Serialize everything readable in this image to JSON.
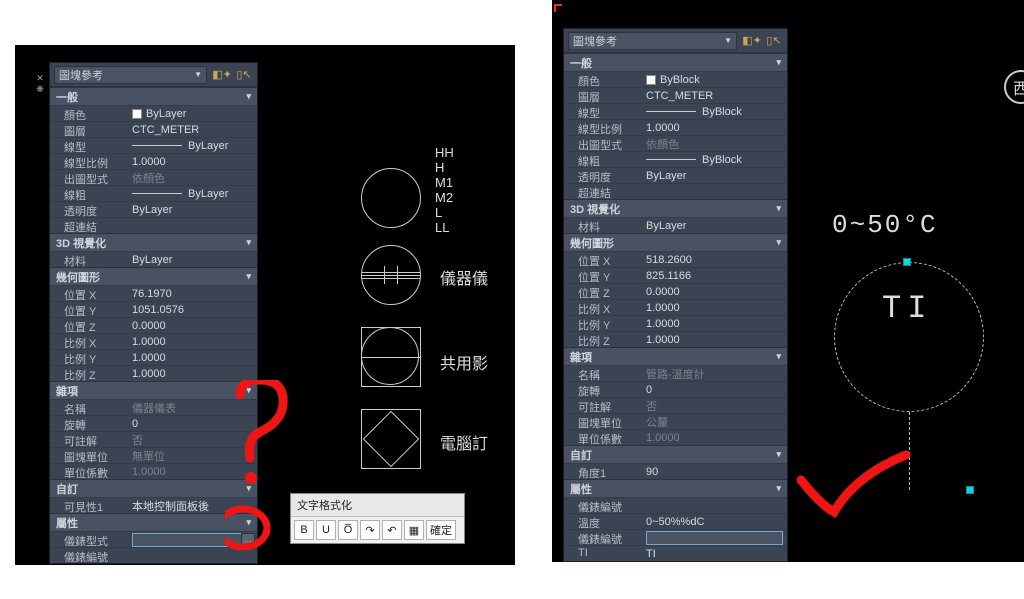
{
  "selector_label": "圖塊參考",
  "left_panel": {
    "sections": [
      {
        "title": "一般",
        "rows": [
          {
            "label": "顏色",
            "value": "ByLayer",
            "swatch": true
          },
          {
            "label": "圖層",
            "value": "CTC_METER"
          },
          {
            "label": "線型",
            "value": "ByLayer",
            "line": true
          },
          {
            "label": "線型比例",
            "value": "1.0000"
          },
          {
            "label": "出圖型式",
            "value": "依顏色",
            "dim": true
          },
          {
            "label": "線粗",
            "value": "ByLayer",
            "line": true
          },
          {
            "label": "透明度",
            "value": "ByLayer"
          },
          {
            "label": "超連結",
            "value": ""
          }
        ]
      },
      {
        "title": "3D 視覺化",
        "rows": [
          {
            "label": "材料",
            "value": "ByLayer"
          }
        ]
      },
      {
        "title": "幾何圖形",
        "rows": [
          {
            "label": "位置 X",
            "value": "76.1970"
          },
          {
            "label": "位置 Y",
            "value": "1051.0576"
          },
          {
            "label": "位置 Z",
            "value": "0.0000"
          },
          {
            "label": "比例 X",
            "value": "1.0000"
          },
          {
            "label": "比例 Y",
            "value": "1.0000"
          },
          {
            "label": "比例 Z",
            "value": "1.0000"
          }
        ]
      },
      {
        "title": "雜項",
        "rows": [
          {
            "label": "名稱",
            "value": "儀器儀表",
            "dim": true
          },
          {
            "label": "旋轉",
            "value": "0"
          },
          {
            "label": "可註解",
            "value": "否",
            "dim": true
          },
          {
            "label": "圖塊單位",
            "value": "無單位",
            "dim": true
          },
          {
            "label": "單位係數",
            "value": "1.0000",
            "dim": true
          }
        ]
      },
      {
        "title": "自訂",
        "rows": [
          {
            "label": "可見性1",
            "value": "本地控制面板後"
          }
        ]
      },
      {
        "title": "屬性",
        "rows": [
          {
            "label": "儀錶型式",
            "value": "",
            "input": true,
            "ellipsis": true
          },
          {
            "label": "儀錶編號",
            "value": ""
          }
        ]
      }
    ]
  },
  "right_panel": {
    "sections": [
      {
        "title": "一般",
        "rows": [
          {
            "label": "顏色",
            "value": "ByBlock",
            "swatch": true
          },
          {
            "label": "圖層",
            "value": "CTC_METER"
          },
          {
            "label": "線型",
            "value": "ByBlock",
            "line": true
          },
          {
            "label": "線型比例",
            "value": "1.0000"
          },
          {
            "label": "出圖型式",
            "value": "依顏色",
            "dim": true
          },
          {
            "label": "線粗",
            "value": "ByBlock",
            "line": true
          },
          {
            "label": "透明度",
            "value": "ByLayer"
          },
          {
            "label": "超連結",
            "value": ""
          }
        ]
      },
      {
        "title": "3D 視覺化",
        "rows": [
          {
            "label": "材料",
            "value": "ByLayer"
          }
        ]
      },
      {
        "title": "幾何圖形",
        "rows": [
          {
            "label": "位置 X",
            "value": "518.2600"
          },
          {
            "label": "位置 Y",
            "value": "825.1166"
          },
          {
            "label": "位置 Z",
            "value": "0.0000"
          },
          {
            "label": "比例 X",
            "value": "1.0000"
          },
          {
            "label": "比例 Y",
            "value": "1.0000"
          },
          {
            "label": "比例 Z",
            "value": "1.0000"
          }
        ]
      },
      {
        "title": "雜項",
        "rows": [
          {
            "label": "名稱",
            "value": "管路-溫度計",
            "dim": true
          },
          {
            "label": "旋轉",
            "value": "0"
          },
          {
            "label": "可註解",
            "value": "否",
            "dim": true
          },
          {
            "label": "圖塊單位",
            "value": "公釐",
            "dim": true
          },
          {
            "label": "單位係數",
            "value": "1.0000",
            "dim": true
          }
        ]
      },
      {
        "title": "自訂",
        "rows": [
          {
            "label": "角度1",
            "value": "90"
          }
        ]
      },
      {
        "title": "屬性",
        "rows": [
          {
            "label": "儀錶編號",
            "value": ""
          },
          {
            "label": "溫度",
            "value": "0~50%%dC"
          },
          {
            "label": "儀錶編號",
            "value": "",
            "input": true
          },
          {
            "label": "TI",
            "value": "TI"
          }
        ]
      }
    ]
  },
  "txt_toolbar": {
    "title": "文字格式化",
    "buttons": [
      "B",
      "U",
      "O̅",
      "↷",
      "↶",
      "▦",
      "確定"
    ]
  },
  "canvas_left": {
    "stack": [
      "HH",
      "H",
      "M1",
      "M2",
      "L",
      "LL"
    ],
    "labels": [
      "儀器儀",
      "共用影",
      "電腦訂"
    ]
  },
  "canvas_right": {
    "title": "0~50°C",
    "inner": "TI",
    "badge": "西"
  }
}
